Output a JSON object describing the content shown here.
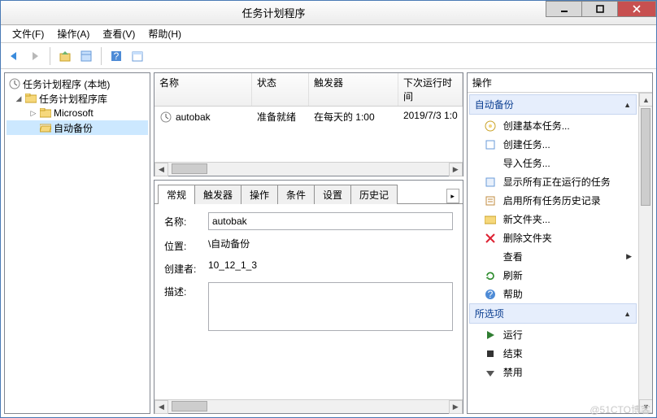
{
  "window": {
    "title": "任务计划程序"
  },
  "menu": {
    "file": "文件(F)",
    "action": "操作(A)",
    "view": "查看(V)",
    "help": "帮助(H)"
  },
  "tree": {
    "root": "任务计划程序 (本地)",
    "library": "任务计划程序库",
    "microsoft": "Microsoft",
    "autobackup": "自动备份"
  },
  "list": {
    "columns": {
      "name": "名称",
      "status": "状态",
      "trigger": "触发器",
      "nextrun": "下次运行时间"
    },
    "rows": [
      {
        "name": "autobak",
        "status": "准备就绪",
        "trigger": "在每天的 1:00",
        "nextrun": "2019/7/3 1:0"
      }
    ]
  },
  "detail": {
    "tabs": {
      "general": "常规",
      "triggers": "触发器",
      "actions": "操作",
      "conditions": "条件",
      "settings": "设置",
      "history": "历史记"
    },
    "labels": {
      "name": "名称:",
      "location": "位置:",
      "author": "创建者:",
      "description": "描述:"
    },
    "values": {
      "name": "autobak",
      "location": "\\自动备份",
      "author": "10_12_1_3",
      "description": ""
    }
  },
  "actions": {
    "pane_title": "操作",
    "group1": "自动备份",
    "group2": "所选项",
    "create_basic": "创建基本任务...",
    "create": "创建任务...",
    "import": "导入任务...",
    "show_running": "显示所有正在运行的任务",
    "enable_history": "启用所有任务历史记录",
    "new_folder": "新文件夹...",
    "delete_folder": "删除文件夹",
    "view": "查看",
    "refresh": "刷新",
    "help": "帮助",
    "run": "运行",
    "end": "结束",
    "disable": "禁用"
  },
  "watermark": "@51CTO博客"
}
